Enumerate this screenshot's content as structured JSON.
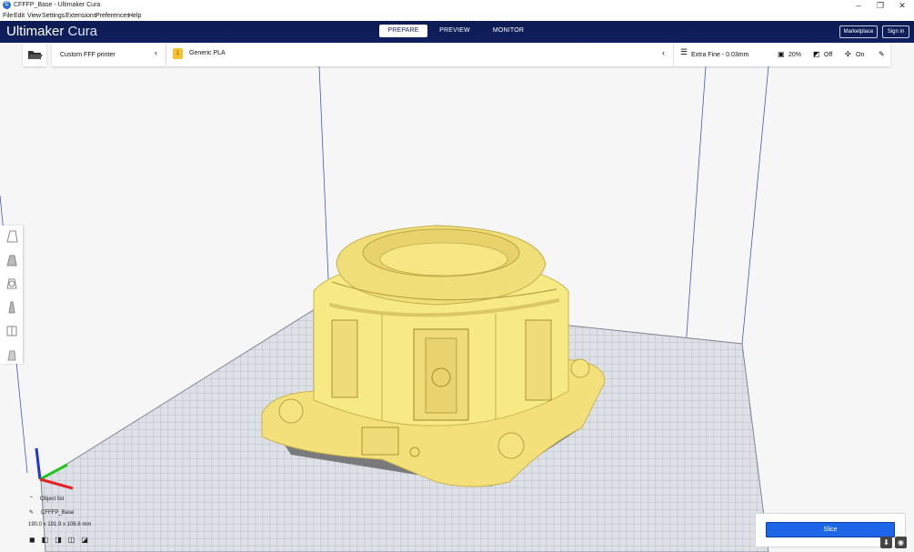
{
  "window": {
    "title": "CFFFP_Base - Ultimaker Cura",
    "controls": [
      "–",
      "❐",
      "✕"
    ]
  },
  "menu": [
    "File",
    "Edit",
    "View",
    "Settings",
    "Extensions",
    "Preferences",
    "Help"
  ],
  "header": {
    "logo_bold": "Ultimaker",
    "logo_light": "Cura",
    "tabs": [
      "PREPARE",
      "PREVIEW",
      "MONITOR"
    ],
    "active_tab": "PREPARE",
    "marketplace": "Marketplace",
    "signin": "Sign in"
  },
  "toolbar": {
    "printer": "Custom FFF printer",
    "material": "Generic PLA",
    "material_slot": "1",
    "profile": "Extra Fine - 0.03mm",
    "infill": "20%",
    "support": "Off",
    "adhesion": "On"
  },
  "object_panel": {
    "list_label": "Object list",
    "object_name": "CFFFP_Base",
    "dimensions": "190.0 x 191.9 x 106.6 mm"
  },
  "slice": {
    "label": "Slice"
  },
  "colors": {
    "header": "#10205f",
    "accent": "#1e66e8",
    "model": "#f7ea85",
    "material_badge": "#f5c12e"
  }
}
